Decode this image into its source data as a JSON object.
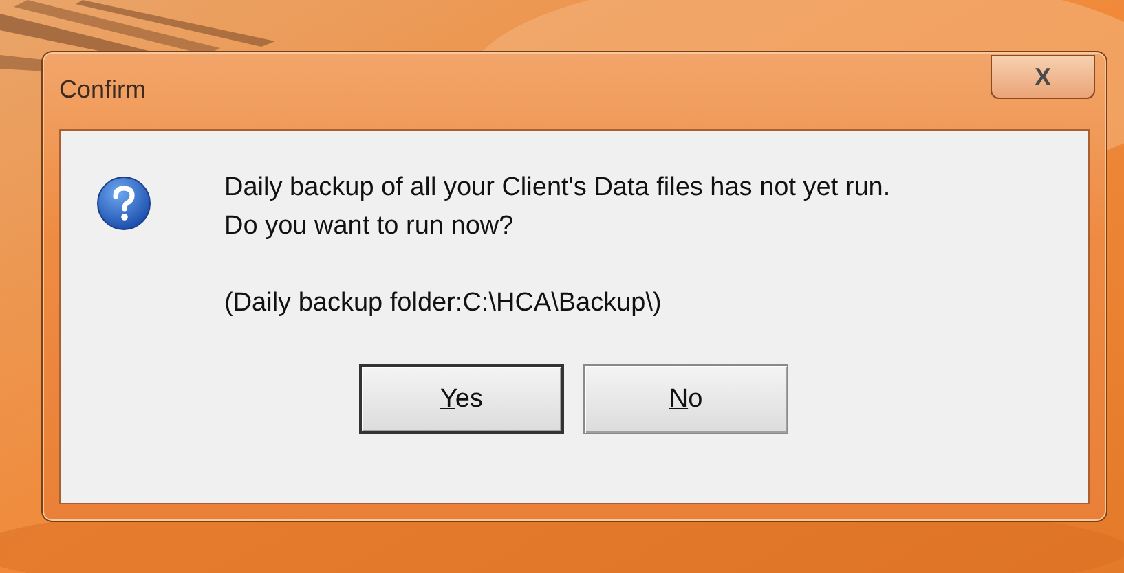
{
  "window": {
    "title": "Confirm",
    "close": "X"
  },
  "message": {
    "lines": [
      "Daily backup of all your Client's Data files has not yet run.",
      "Do you want to run now?"
    ],
    "note": "(Daily backup folder:C:\\HCA\\Backup\\)"
  },
  "buttons": [
    {
      "label": "Yes",
      "mnemonic_underlined": true,
      "focused": true
    },
    {
      "label": "No",
      "mnemonic_underlined": true,
      "focused": false
    }
  ]
}
